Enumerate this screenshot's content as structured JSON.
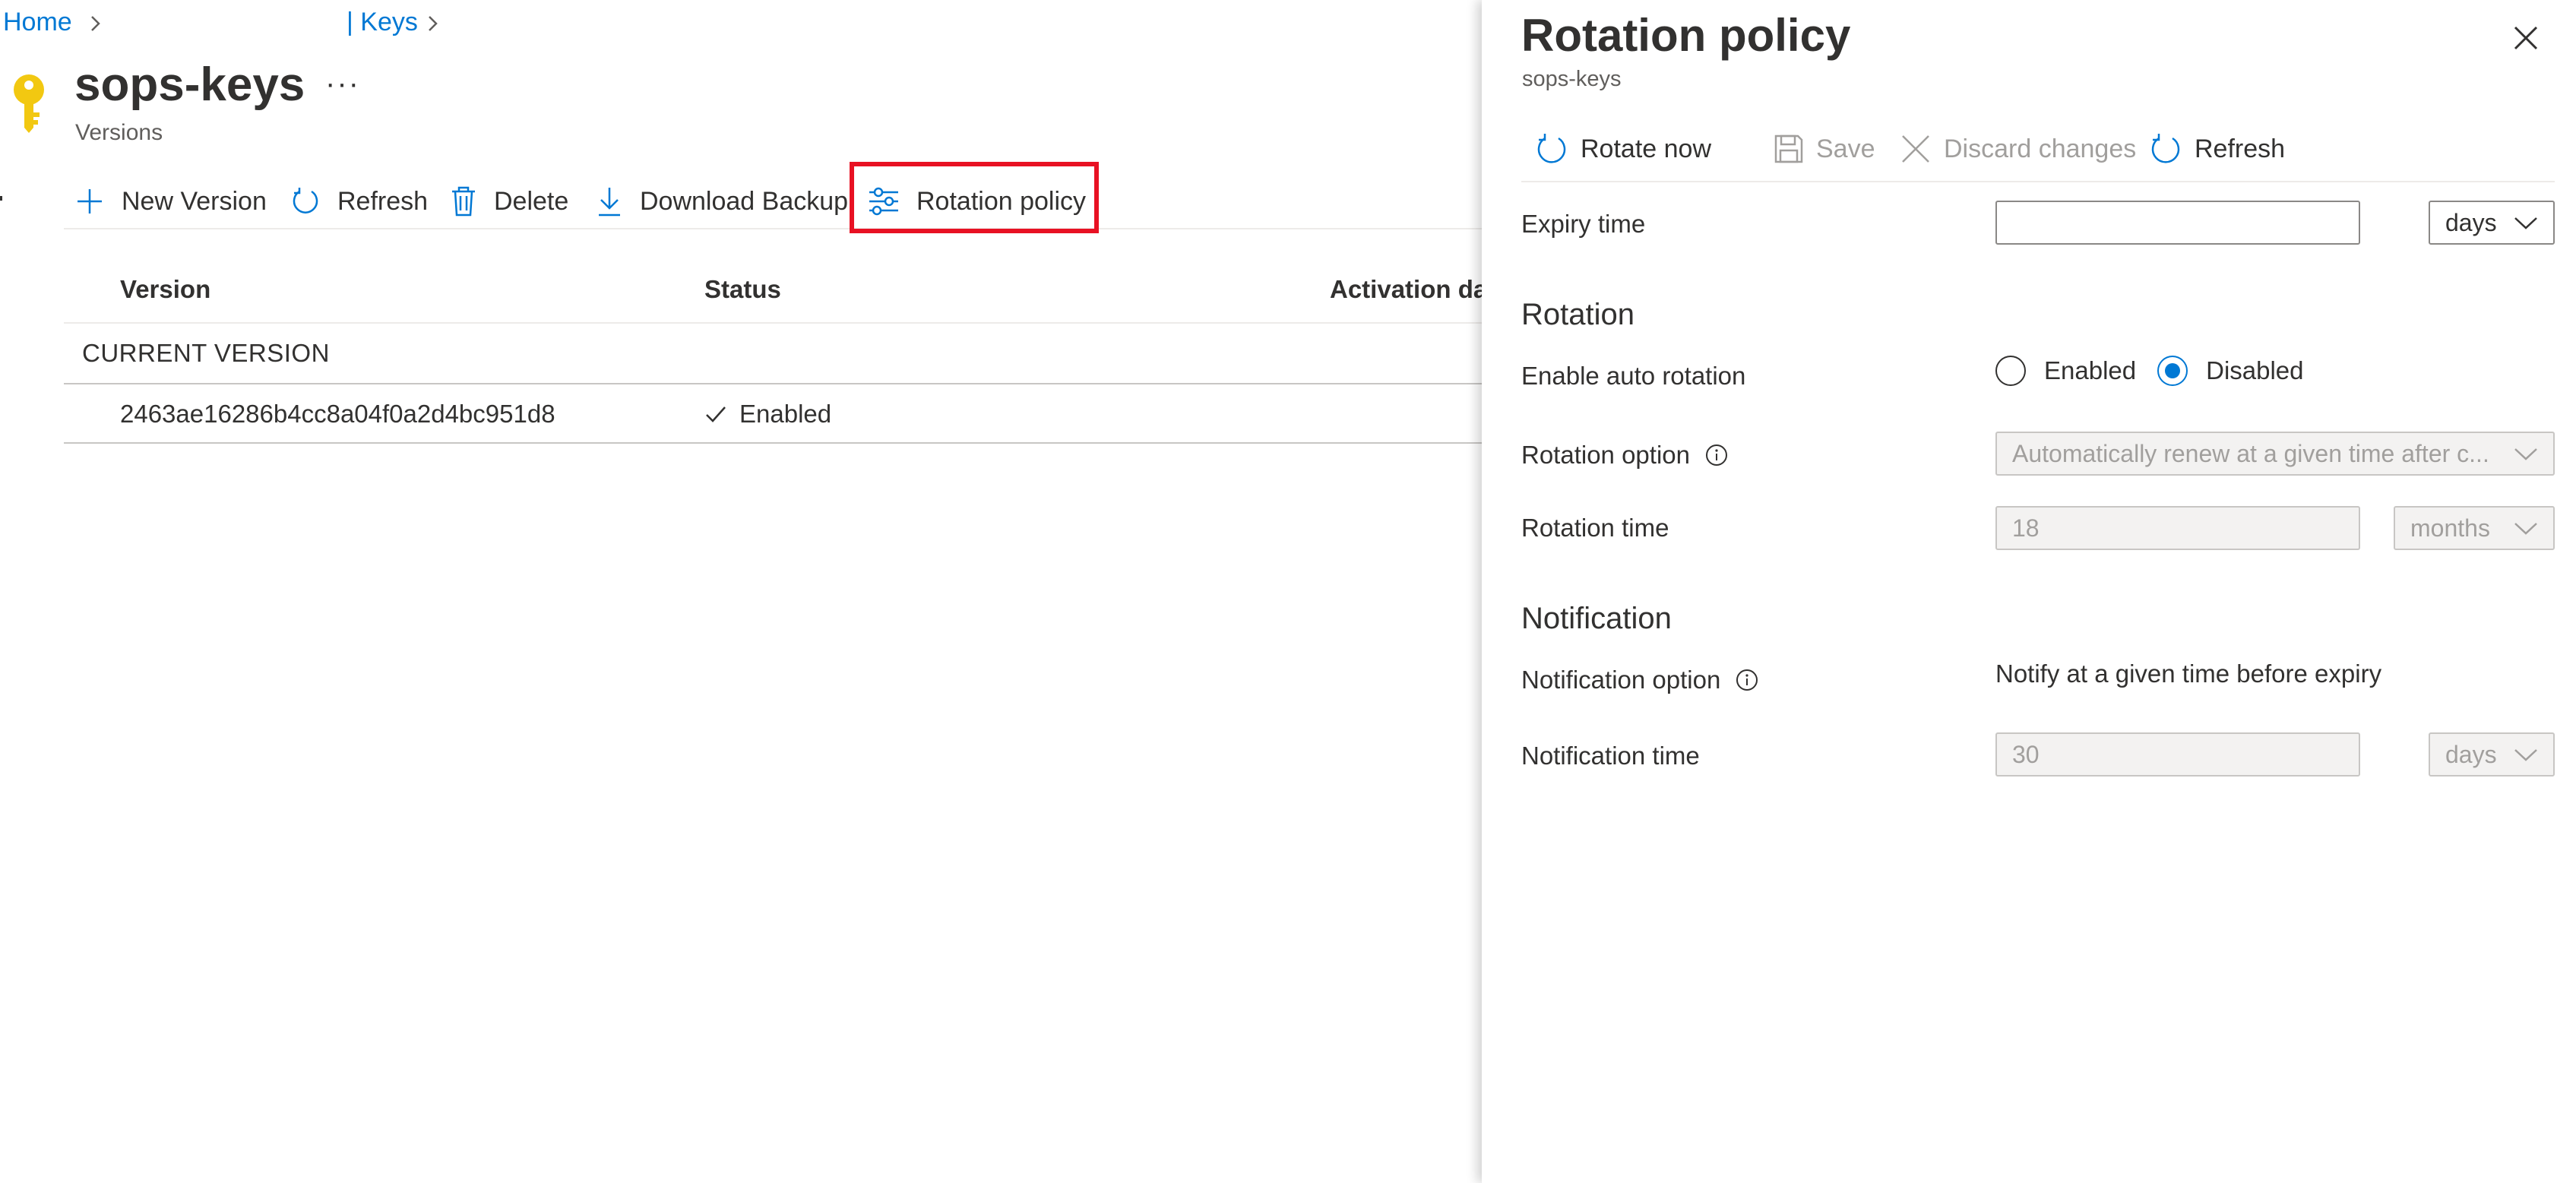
{
  "breadcrumb": {
    "home": "Home",
    "keys": "| Keys"
  },
  "page": {
    "title": "sops-keys",
    "more": "···",
    "subtitle": "Versions"
  },
  "toolbar": {
    "new_version": "New Version",
    "refresh": "Refresh",
    "delete": "Delete",
    "download_backup": "Download Backup",
    "rotation_policy": "Rotation policy"
  },
  "table": {
    "columns": [
      "Version",
      "Status",
      "Activation dat"
    ],
    "group_label": "CURRENT VERSION",
    "rows": [
      {
        "version": "2463ae16286b4cc8a04f0a2d4bc951d8",
        "status": "Enabled"
      }
    ]
  },
  "panel": {
    "title": "Rotation policy",
    "subtitle": "sops-keys",
    "toolbar": {
      "rotate_now": "Rotate now",
      "save": "Save",
      "discard": "Discard changes",
      "refresh": "Refresh"
    },
    "expiry": {
      "label": "Expiry time",
      "value": "",
      "unit": "days"
    },
    "rotation": {
      "heading": "Rotation",
      "auto_label": "Enable auto rotation",
      "enabled_label": "Enabled",
      "disabled_label": "Disabled",
      "selected": "Disabled",
      "option_label": "Rotation option",
      "option_value": "Automatically renew at a given time after c...",
      "time_label": "Rotation time",
      "time_value": "18",
      "time_unit": "months"
    },
    "notification": {
      "heading": "Notification",
      "option_label": "Notification option",
      "option_value": "Notify at a given time before expiry",
      "time_label": "Notification time",
      "time_value": "30",
      "time_unit": "days"
    }
  },
  "colors": {
    "accent": "#0078d4",
    "highlight": "#e81123",
    "key_icon": "#f2c811"
  },
  "icons": [
    "chevron-right-icon",
    "key-icon",
    "plus-icon",
    "refresh-icon",
    "trash-icon",
    "download-icon",
    "sliders-icon",
    "checkmark-icon",
    "close-icon",
    "save-icon",
    "info-icon",
    "chevron-down-icon"
  ]
}
